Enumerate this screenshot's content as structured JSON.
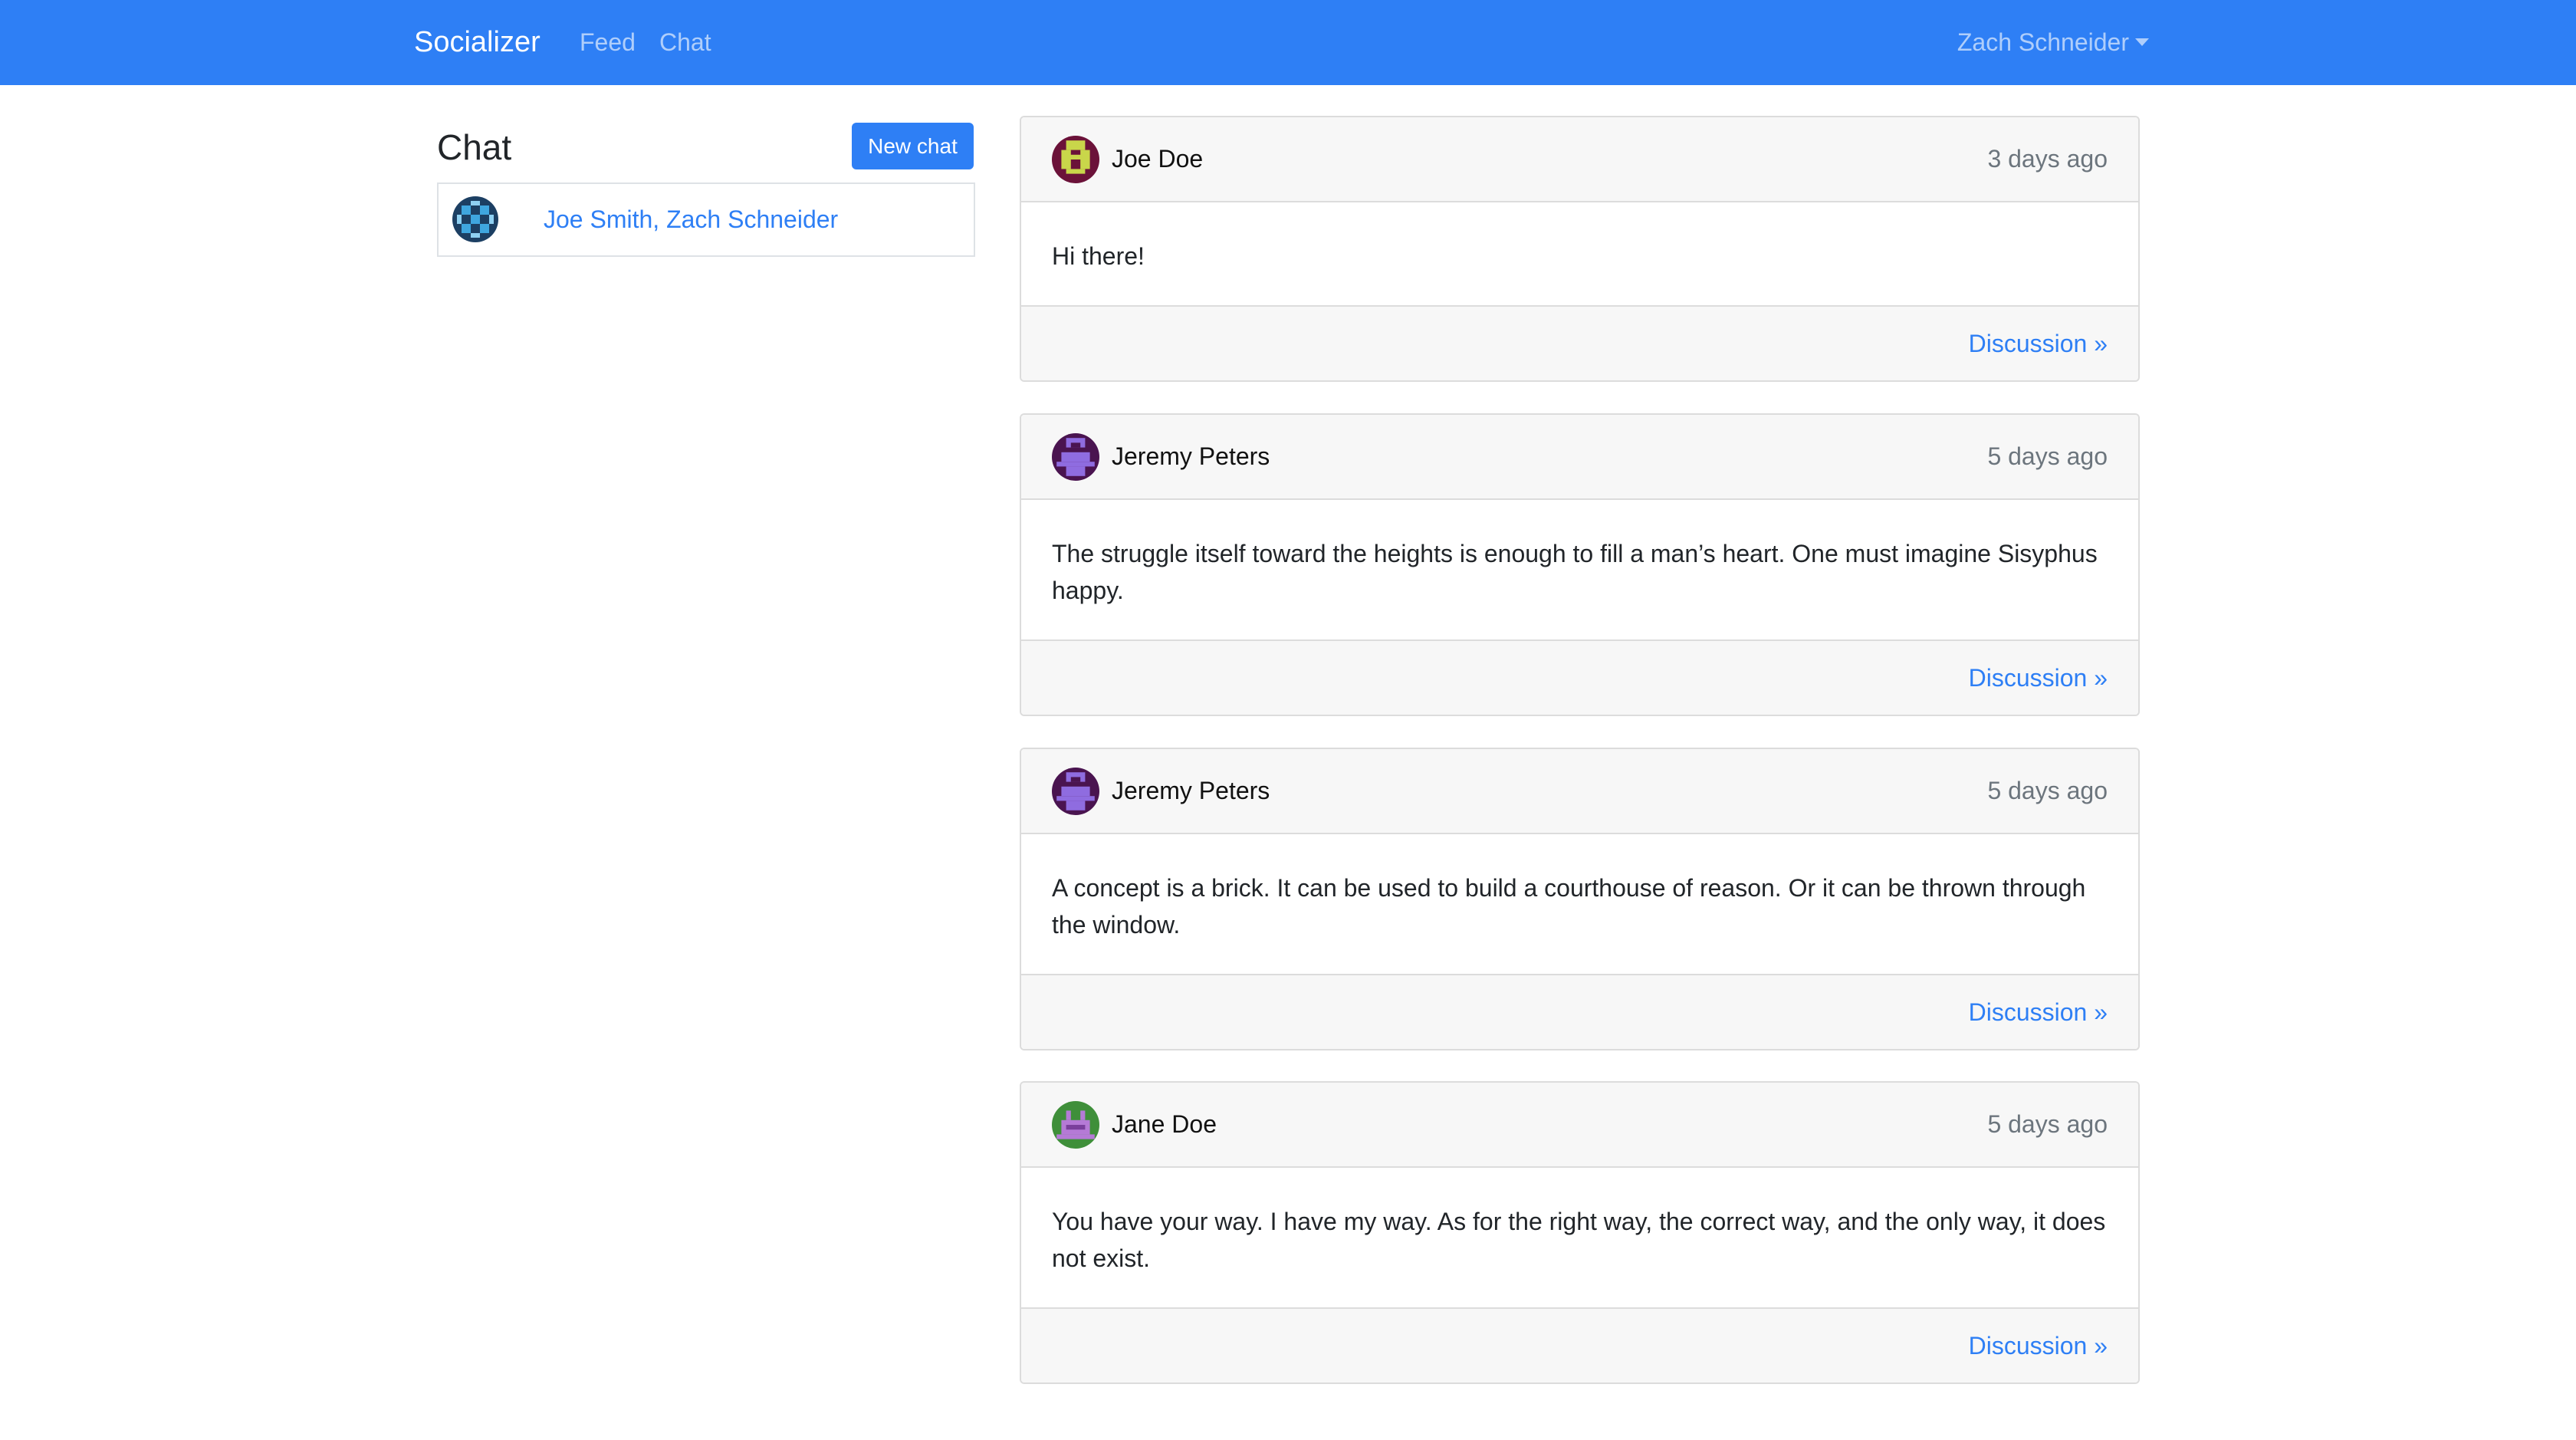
{
  "navbar": {
    "brand": "Socializer",
    "links": [
      "Feed",
      "Chat"
    ],
    "user": "Zach Schneider"
  },
  "sidebar": {
    "title": "Chat",
    "new_chat_label": "New chat",
    "chats": [
      {
        "name": "Joe Smith, Zach Schneider",
        "avatar_icon": "identicon-avatar-blue"
      }
    ]
  },
  "posts": [
    {
      "author": "Joe Doe",
      "time": "3 days ago",
      "body": "Hi there!",
      "link": "Discussion »",
      "avatar_icon": "identicon-avatar-yellow"
    },
    {
      "author": "Jeremy Peters",
      "time": "5 days ago",
      "body": "The struggle itself toward the heights is enough to fill a man’s heart. One must imagine Sisyphus happy.",
      "link": "Discussion »",
      "avatar_icon": "identicon-avatar-purple"
    },
    {
      "author": "Jeremy Peters",
      "time": "5 days ago",
      "body": "A concept is a brick. It can be used to build a courthouse of reason. Or it can be thrown through the window.",
      "link": "Discussion »",
      "avatar_icon": "identicon-avatar-purple"
    },
    {
      "author": "Jane Doe",
      "time": "5 days ago",
      "body": "You have your way. I have my way. As for the right way, the correct way, and the only way, it does not exist.",
      "link": "Discussion »",
      "avatar_icon": "identicon-avatar-green"
    }
  ],
  "colors": {
    "primary": "#2e7ff5",
    "navbar_bg": "#2e7ff5",
    "card_header_bg": "#f7f7f7",
    "muted_text": "#6c757d"
  }
}
